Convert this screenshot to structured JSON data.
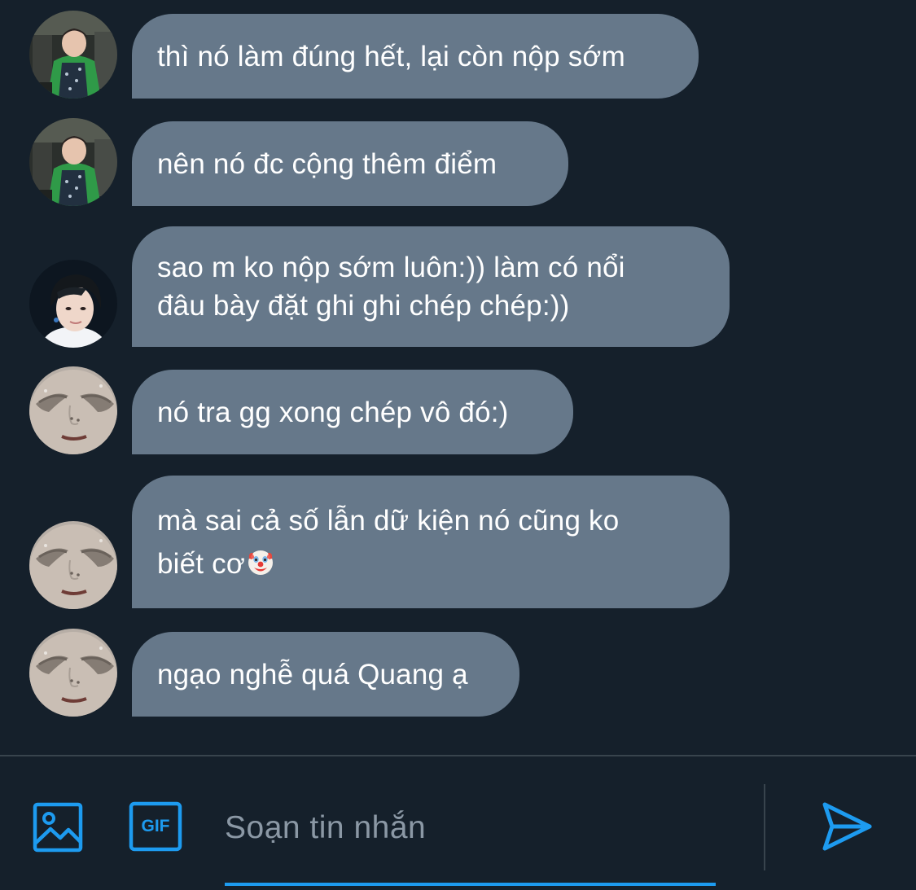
{
  "conversation": {
    "messages": [
      {
        "avatar": "avatar-green-jacket",
        "lines": [
          "thì nó làm đúng hết, lại còn nộp sớm"
        ]
      },
      {
        "avatar": "avatar-green-jacket",
        "lines": [
          "nên nó đc cộng thêm điểm"
        ]
      },
      {
        "avatar": "avatar-dark-hair",
        "lines": [
          "sao m ko nộp sớm luôn:)) làm có nổi",
          "đâu bày đặt ghi ghi chép chép:))"
        ]
      },
      {
        "avatar": "avatar-face-closeup",
        "lines": [
          "nó tra gg xong chép vô đó:)"
        ]
      },
      {
        "avatar": "avatar-face-closeup",
        "lines": [
          "mà sai cả số lẫn dữ kiện nó cũng ko",
          "biết cơ"
        ],
        "emoji": "clown-face"
      },
      {
        "avatar": "avatar-face-closeup",
        "lines": [
          "ngạo nghễ quá Quang ạ"
        ]
      }
    ]
  },
  "composer": {
    "placeholder": "Soạn tin nhắn",
    "value": "",
    "image_icon": "image-icon",
    "gif_icon": "gif-icon",
    "gif_label": "GIF",
    "send_icon": "send-icon"
  },
  "colors": {
    "background": "#15202b",
    "bubble": "#66788a",
    "accent": "#1d9bf0",
    "divider": "#38444d",
    "placeholder": "#8b98a5"
  }
}
